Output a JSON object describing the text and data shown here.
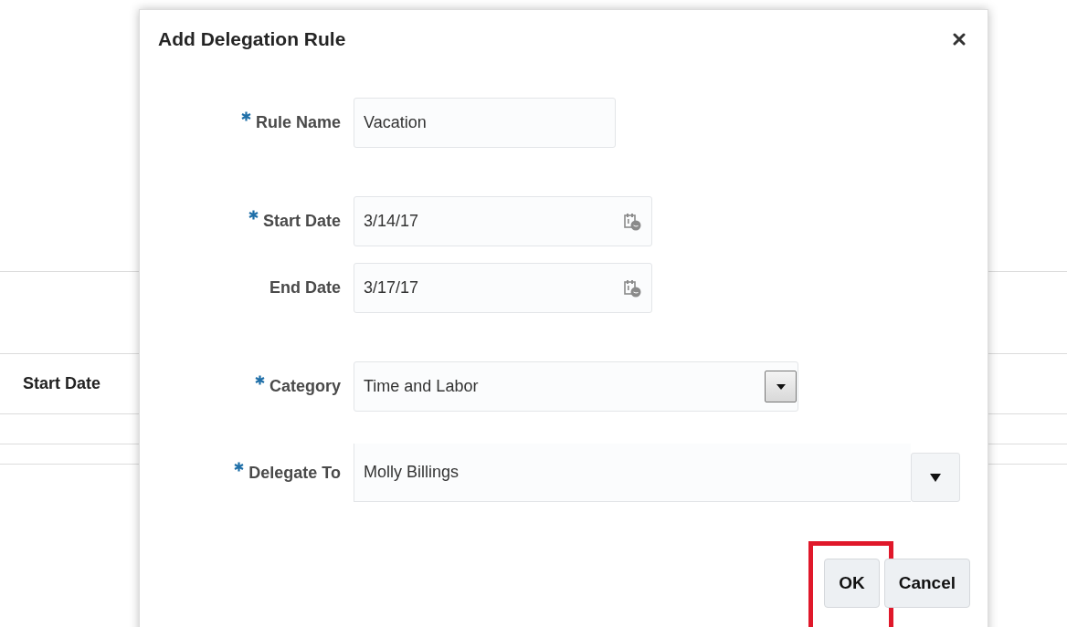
{
  "background": {
    "column_header": "Start Date"
  },
  "dialog": {
    "title": "Add Delegation Rule",
    "fields": [
      {
        "kind": "text",
        "label": "Rule Name",
        "required": true,
        "value": "Vacation"
      },
      {
        "kind": "date",
        "label": "Start Date",
        "required": true,
        "value": "3/14/17"
      },
      {
        "kind": "date",
        "label": "End Date",
        "required": false,
        "value": "3/17/17"
      },
      {
        "kind": "select",
        "label": "Category",
        "required": true,
        "value": "Time and Labor"
      },
      {
        "kind": "combo",
        "label": "Delegate To",
        "required": true,
        "value": "Molly Billings"
      }
    ],
    "buttons": [
      {
        "label": "OK",
        "highlighted": true
      },
      {
        "label": "Cancel",
        "highlighted": false
      }
    ]
  }
}
